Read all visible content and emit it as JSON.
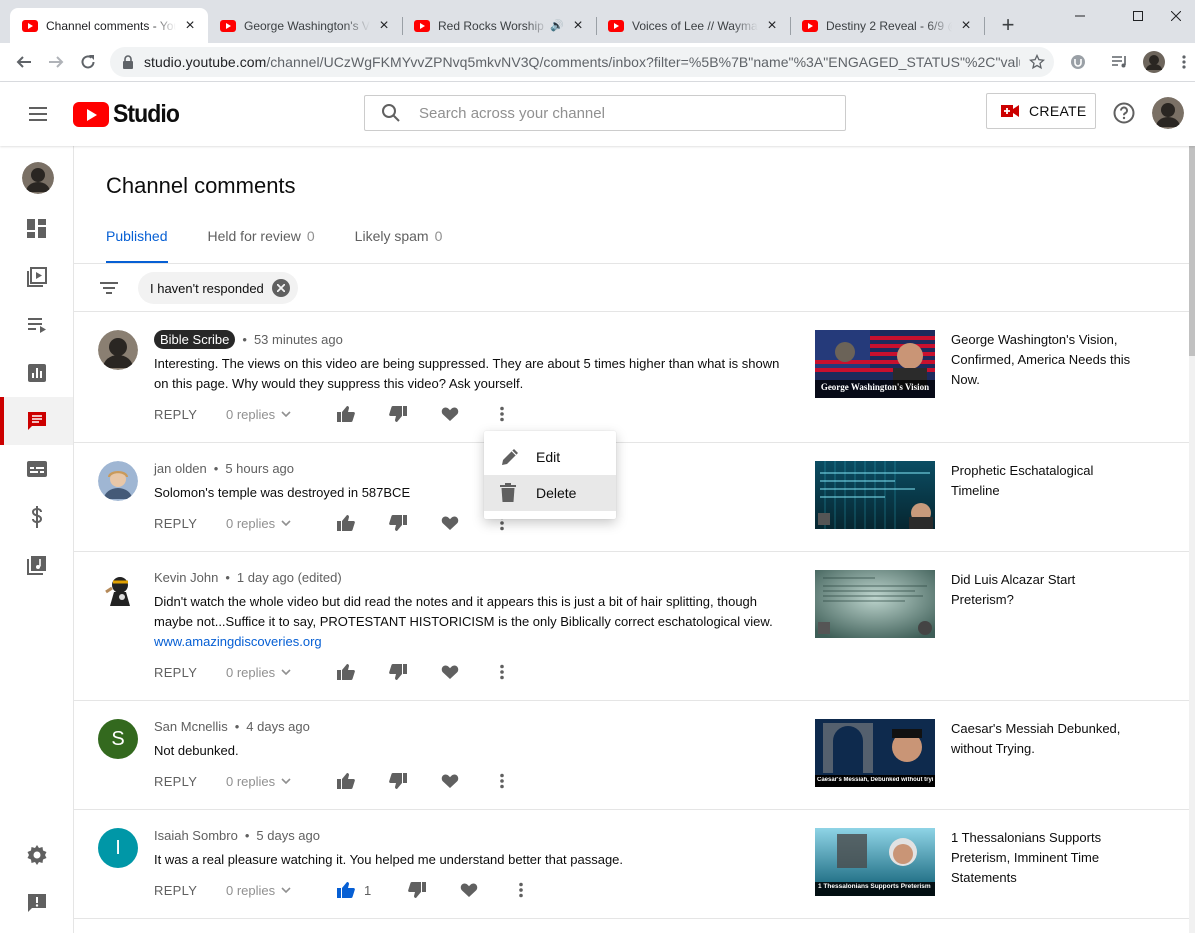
{
  "browser": {
    "tabs": [
      {
        "title": "Channel comments - YouTube Studio",
        "active": true
      },
      {
        "title": "George Washington's Vision"
      },
      {
        "title": "Red Rocks Worship -",
        "audio": true
      },
      {
        "title": "Voices of Lee // Wayma"
      },
      {
        "title": "Destiny 2 Reveal - 6/9 @"
      }
    ],
    "new_tab": "+",
    "url_host": "studio.youtube.com",
    "url_path": "/channel/UCzWgFKMYvvZPNvq5mkvNV3Q/comments/inbox?filter=%5B%7B\"name\"%3A\"ENGAGED_STATUS\"%2C\"value..."
  },
  "header": {
    "logo_text": "Studio",
    "search_placeholder": "Search across your channel",
    "create_label": "CREATE"
  },
  "page": {
    "title": "Channel comments",
    "tabs": [
      {
        "label": "Published",
        "count": ""
      },
      {
        "label": "Held for review",
        "count": "0"
      },
      {
        "label": "Likely spam",
        "count": "0"
      }
    ],
    "filter_chip": "I haven't responded"
  },
  "comments": [
    {
      "author": "Bible Scribe",
      "badge": true,
      "time": "53 minutes ago",
      "text": "Interesting. The views on this video are being suppressed. They are about 5 times higher than what is shown on this page. Why would they suppress this video? Ask yourself.",
      "link": "",
      "reply": "REPLY",
      "replies": "0 replies",
      "likes": "",
      "video_title": "George Washington's Vision, Confirmed, America Needs this Now.",
      "thumb_caption": "George Washington's Vision",
      "avatar_color": "#3a3530"
    },
    {
      "author": "jan olden",
      "badge": false,
      "time": "5 hours ago",
      "text": "Solomon's temple was destroyed in 587BCE",
      "link": "",
      "reply": "REPLY",
      "replies": "0 replies",
      "likes": "",
      "video_title": "Prophetic Eschatalogical Timeline",
      "thumb_caption": "",
      "avatar_color": "#8aa6c8"
    },
    {
      "author": "Kevin John",
      "badge": false,
      "time": "1 day ago (edited)",
      "text": "Didn't watch the whole video but did read the notes and it appears this is just a bit of hair splitting, though maybe not...Suffice it to say, PROTESTANT HISTORICISM is the only Biblically correct eschatological view.",
      "link": "www.amazingdiscoveries.org",
      "reply": "REPLY",
      "replies": "0 replies",
      "likes": "",
      "video_title": "Did Luis Alcazar Start Preterism?",
      "thumb_caption": "",
      "avatar_color": "#ffffff"
    },
    {
      "author": "San Mcnellis",
      "badge": false,
      "time": "4 days ago",
      "text": "Not debunked.",
      "link": "",
      "reply": "REPLY",
      "replies": "0 replies",
      "likes": "",
      "avatar_letter": "S",
      "video_title": "Caesar's Messiah Debunked, without Trying.",
      "thumb_caption": "Caesar's Messiah, Debunked without trying.",
      "avatar_color": "#33691e"
    },
    {
      "author": "Isaiah Sombro",
      "badge": false,
      "time": "5 days ago",
      "text": "It was a real pleasure watching it. You helped me understand better that passage.",
      "link": "",
      "reply": "REPLY",
      "replies": "0 replies",
      "likes": "1",
      "avatar_letter": "I",
      "video_title": "1 Thessalonians Supports Preterism, Imminent Time Statements",
      "thumb_caption": "1 Thessalonians Supports Preterism",
      "avatar_color": "#0097a7"
    }
  ],
  "menu": {
    "edit": "Edit",
    "delete": "Delete"
  },
  "colors": {
    "accent": "#065fd4",
    "brand": "#ff0000",
    "active_rail": "#cc0000"
  }
}
